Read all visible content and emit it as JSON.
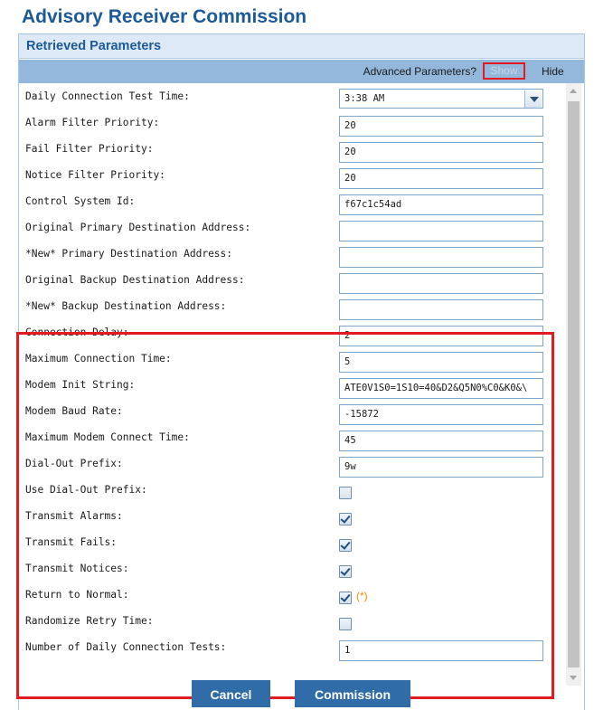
{
  "page": {
    "title": "Advisory Receiver Commission"
  },
  "section": {
    "title": "Retrieved Parameters"
  },
  "advanced": {
    "label": "Advanced Parameters?",
    "show_label": "Show",
    "hide_label": "Hide"
  },
  "fields": {
    "daily_connection_test_time": {
      "label": "Daily Connection Test Time:",
      "value": "3:38 AM"
    },
    "alarm_filter_priority": {
      "label": "Alarm Filter Priority:",
      "value": "20"
    },
    "fail_filter_priority": {
      "label": "Fail Filter Priority:",
      "value": "20"
    },
    "notice_filter_priority": {
      "label": "Notice Filter Priority:",
      "value": "20"
    },
    "control_system_id": {
      "label": "Control System Id:",
      "value": "f67c1c54ad"
    },
    "orig_primary_dest": {
      "label": "Original Primary Destination Address:",
      "value": ""
    },
    "new_primary_dest": {
      "label": "*New* Primary Destination Address:",
      "value": ""
    },
    "orig_backup_dest": {
      "label": "Original Backup Destination Address:",
      "value": ""
    },
    "new_backup_dest": {
      "label": "*New* Backup Destination Address:",
      "value": ""
    },
    "connection_delay": {
      "label": "Connection Delay:",
      "value": "2"
    },
    "max_connection_time": {
      "label": "Maximum Connection Time:",
      "value": "5"
    },
    "modem_init_string": {
      "label": "Modem Init String:",
      "value": "ATE0V1S0=1S10=40&D2&Q5N0%C0&K0&\\"
    },
    "modem_baud_rate": {
      "label": "Modem Baud Rate:",
      "value": "-15872"
    },
    "max_modem_connect_time": {
      "label": "Maximum Modem Connect Time:",
      "value": "45"
    },
    "dial_out_prefix": {
      "label": "Dial-Out Prefix:",
      "value": "9w"
    },
    "use_dial_out_prefix": {
      "label": "Use Dial-Out Prefix:",
      "checked": false
    },
    "transmit_alarms": {
      "label": "Transmit Alarms:",
      "checked": true
    },
    "transmit_fails": {
      "label": "Transmit Fails:",
      "checked": true
    },
    "transmit_notices": {
      "label": "Transmit Notices:",
      "checked": true
    },
    "return_to_normal": {
      "label": "Return to Normal:",
      "checked": true,
      "note": "(*)"
    },
    "randomize_retry_time": {
      "label": "Randomize Retry Time:",
      "checked": false
    },
    "number_daily_connection_tests": {
      "label": "Number of Daily Connection Tests:",
      "value": "1"
    }
  },
  "buttons": {
    "cancel": "Cancel",
    "commission": "Commission"
  },
  "colors": {
    "title": "#1c5a98",
    "header_bar": "#94b8dc",
    "highlight": "#e21b23",
    "button": "#2f6ca8",
    "note": "#f08c00"
  }
}
